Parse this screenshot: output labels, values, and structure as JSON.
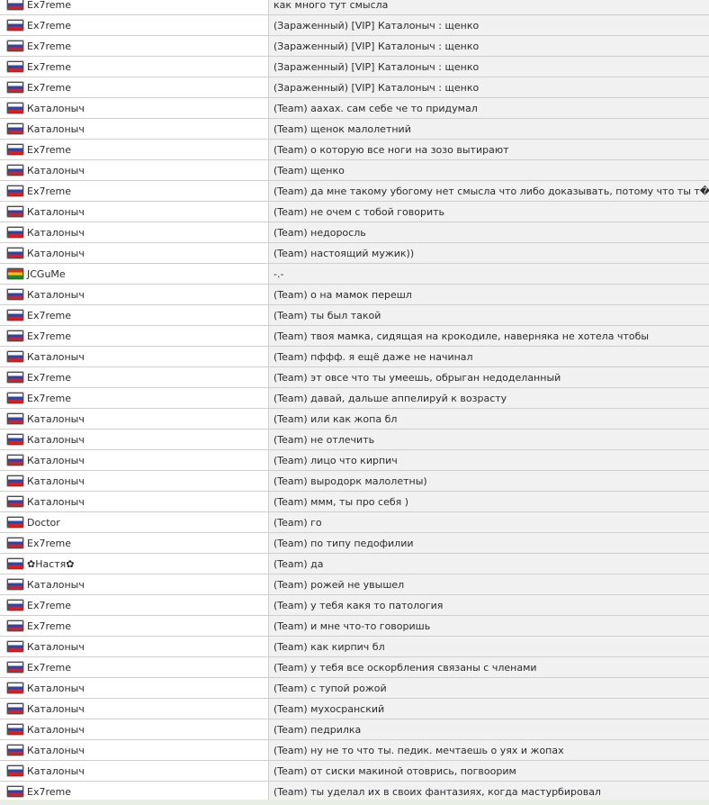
{
  "chat": {
    "rows": [
      {
        "flag": "ru",
        "name": "Ex7reme",
        "message": "как много тут смысла"
      },
      {
        "flag": "ru",
        "name": "Ex7reme",
        "message": "(Зараженный) [VIP] Каталоныч : щенко"
      },
      {
        "flag": "ru",
        "name": "Ex7reme",
        "message": "(Зараженный) [VIP] Каталоныч : щенко"
      },
      {
        "flag": "ru",
        "name": "Ex7reme",
        "message": "(Зараженный) [VIP] Каталоныч : щенко"
      },
      {
        "flag": "ru",
        "name": "Ex7reme",
        "message": "(Зараженный) [VIP] Каталоныч : щенко"
      },
      {
        "flag": "ru",
        "name": "Каталоныч",
        "message": "(Team) аахах. сам себе че то придумал"
      },
      {
        "flag": "ru",
        "name": "Каталоныч",
        "message": "(Team) щенок малолетний"
      },
      {
        "flag": "ru",
        "name": "Ex7reme",
        "message": "(Team) о которую все ноги на зозо вытирают"
      },
      {
        "flag": "ru",
        "name": "Каталоныч",
        "message": "(Team) щенко"
      },
      {
        "flag": "ru",
        "name": "Ex7reme",
        "message": "(Team) да мне такому убогому нет смысла что либо доказывать, потому что ты т�"
      },
      {
        "flag": "ru",
        "name": "Каталоныч",
        "message": "(Team) не очем с тобой говорить"
      },
      {
        "flag": "ru",
        "name": "Каталоныч",
        "message": "(Team) недоросль"
      },
      {
        "flag": "ru",
        "name": "Каталоныч",
        "message": "(Team) настоящий мужик))"
      },
      {
        "flag": "bo",
        "name": "JCGuMe",
        "message": "-.-"
      },
      {
        "flag": "ru",
        "name": "Каталоныч",
        "message": "(Team) о на мамок перешл"
      },
      {
        "flag": "ru",
        "name": "Ex7reme",
        "message": "(Team) ты был такой"
      },
      {
        "flag": "ru",
        "name": "Ex7reme",
        "message": "(Team) твоя мамка, сидящая на крокодиле, наверняка не хотела чтобы"
      },
      {
        "flag": "ru",
        "name": "Каталоныч",
        "message": "(Team) пффф. я ещё даже не начинал"
      },
      {
        "flag": "ru",
        "name": "Ex7reme",
        "message": "(Team) эт овсе что ты умеешь, обрыган недоделанный"
      },
      {
        "flag": "ru",
        "name": "Ex7reme",
        "message": "(Team) давай, дальше аппелируй к возрасту"
      },
      {
        "flag": "ru",
        "name": "Каталоныч",
        "message": "(Team) или как жопа бл"
      },
      {
        "flag": "ru",
        "name": "Каталоныч",
        "message": "(Team) не отлечить"
      },
      {
        "flag": "ru",
        "name": "Каталоныч",
        "message": "(Team) лицо что кирпич"
      },
      {
        "flag": "ru",
        "name": "Каталоныч",
        "message": "(Team) выродорк малолетны)"
      },
      {
        "flag": "ru",
        "name": "Каталоныч",
        "message": "(Team) ммм, ты про себя )"
      },
      {
        "flag": "ru",
        "name": "Doctor",
        "message": "(Team) го"
      },
      {
        "flag": "ru",
        "name": "Ex7reme",
        "message": "(Team) по типу педофилии"
      },
      {
        "flag": "ru",
        "name": "✿Настя✿",
        "message": "(Team) да"
      },
      {
        "flag": "ru",
        "name": "Каталоныч",
        "message": "(Team) рожей не увышел"
      },
      {
        "flag": "ru",
        "name": "Ex7reme",
        "message": "(Team) у тебя какя то патология"
      },
      {
        "flag": "ru",
        "name": "Ex7reme",
        "message": "(Team) и мне что-то говоришь"
      },
      {
        "flag": "ru",
        "name": "Каталоныч",
        "message": "(Team) как кирпич бл"
      },
      {
        "flag": "ru",
        "name": "Ex7reme",
        "message": "(Team) у тебя все оскорбления связаны с членами"
      },
      {
        "flag": "ru",
        "name": "Каталоныч",
        "message": "(Team) с тупой рожой"
      },
      {
        "flag": "ru",
        "name": "Каталоныч",
        "message": "(Team) мухосранский"
      },
      {
        "flag": "ru",
        "name": "Каталоныч",
        "message": "(Team) педрилка"
      },
      {
        "flag": "ru",
        "name": "Каталоныч",
        "message": "(Team) ну не то что ты. педик. мечтаешь о уях и жопах"
      },
      {
        "flag": "ru",
        "name": "Каталоныч",
        "message": "(Team) от сиски макиной отоврись, погвоорим"
      },
      {
        "flag": "ru",
        "name": "Ex7reme",
        "message": "(Team) ты уделал их в своих фантазиях, когда мастурбировал"
      }
    ]
  },
  "colors": {
    "name_bg": "#ffffff",
    "message_bg": "#f1f1f1",
    "border": "#cfcfcf",
    "text": "#2b2b2b"
  }
}
